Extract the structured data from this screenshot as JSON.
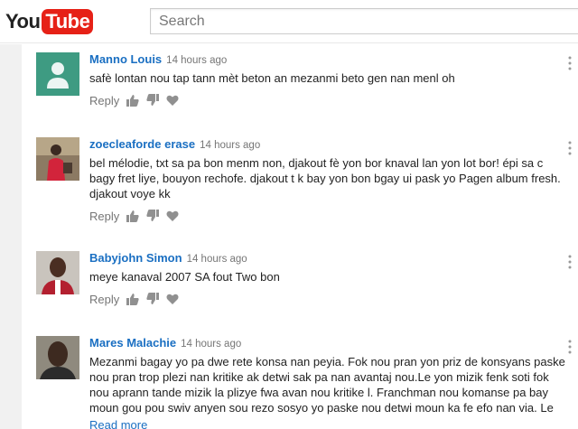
{
  "header": {
    "logo_you": "You",
    "logo_tube": "Tube",
    "search_placeholder": "Search"
  },
  "colors": {
    "brand_red": "#e62117",
    "author_blue": "#1a6fc2",
    "meta_gray": "#767676"
  },
  "comments": [
    {
      "author": "Manno Louis",
      "time": "14 hours ago",
      "text": "safè lontan nou tap tann mèt beton an mezanmi beto gen nan menl oh",
      "reply_label": "Reply",
      "avatar": "default-avatar-icon"
    },
    {
      "author": "zoecleaforde erase",
      "time": "14 hours ago",
      "text": "bel mélodie, txt sa pa bon menm non, djakout fè yon bor knaval lan yon lot bor! épi sa c bagy fret liye, bouyon rechofe. djakout t k bay yon bon bgay ui pask yo Pagen album fresh. djakout voye kk",
      "reply_label": "Reply",
      "avatar": "user-photo"
    },
    {
      "author": "Babyjohn Simon",
      "time": "14 hours ago",
      "text": "meye kanaval 2007 SA fout Two bon",
      "reply_label": "Reply",
      "avatar": "user-photo"
    },
    {
      "author": "Mares Malachie",
      "time": "14 hours ago",
      "text": "Mezanmi bagay yo pa dwe rete konsa nan peyia. Fok nou pran yon priz de konsyans paske nou pran trop plezi nan kritike ak detwi sak pa nan avantaj nou.Le yon mizik fenk soti fok nou aprann tande mizik la plizye fwa avan nou kritike l. Franchman nou komanse pa bay moun gou pou swiv anyen sou rezo sosyo yo paske nou detwi moun ka fe efo nan via. Le",
      "read_more": "Read more",
      "avatar": "user-photo"
    }
  ]
}
